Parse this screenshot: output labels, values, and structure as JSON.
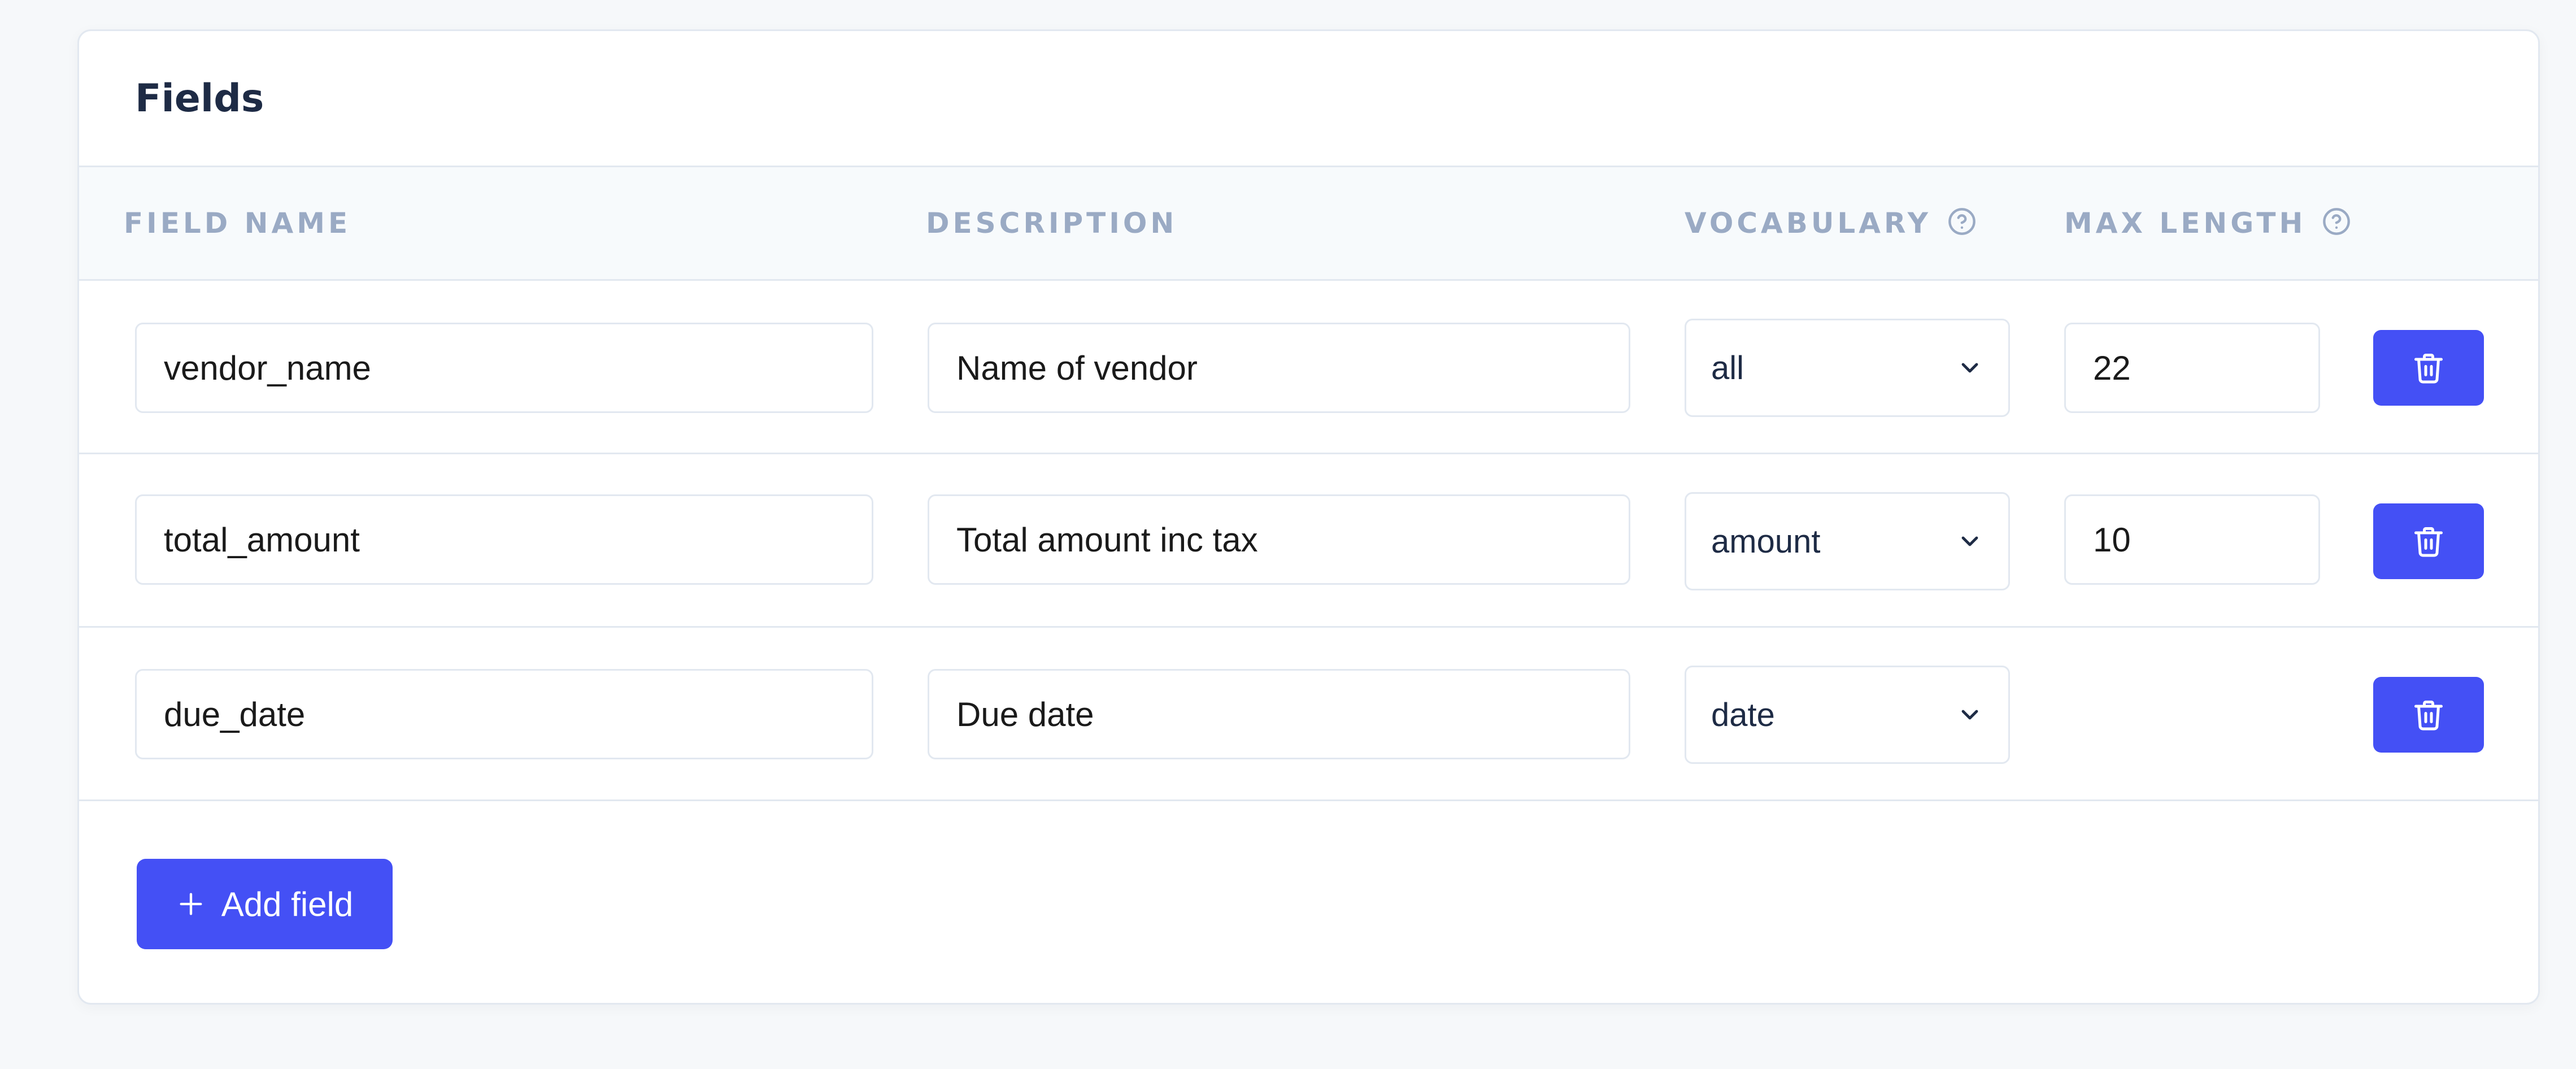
{
  "card": {
    "title": "Fields"
  },
  "columns": {
    "field_name": "FIELD NAME",
    "description": "DESCRIPTION",
    "vocabulary": "VOCABULARY",
    "max_length": "MAX LENGTH"
  },
  "rows": [
    {
      "field_name": "vendor_name",
      "description": "Name of vendor",
      "vocabulary": "all",
      "max_length": "22"
    },
    {
      "field_name": "total_amount",
      "description": "Total amount inc tax",
      "vocabulary": "amount",
      "max_length": "10"
    },
    {
      "field_name": "due_date",
      "description": "Due date",
      "vocabulary": "date",
      "max_length": ""
    }
  ],
  "actions": {
    "add_field_label": "Add field"
  },
  "icons": {
    "help": "help-circle-icon",
    "chevron": "chevron-down-icon",
    "delete": "trash-icon",
    "add": "plus-icon"
  },
  "colors": {
    "accent": "#4450f5",
    "title": "#1e2b45",
    "header_text": "#9aaac4",
    "border": "#e2e8f0"
  }
}
